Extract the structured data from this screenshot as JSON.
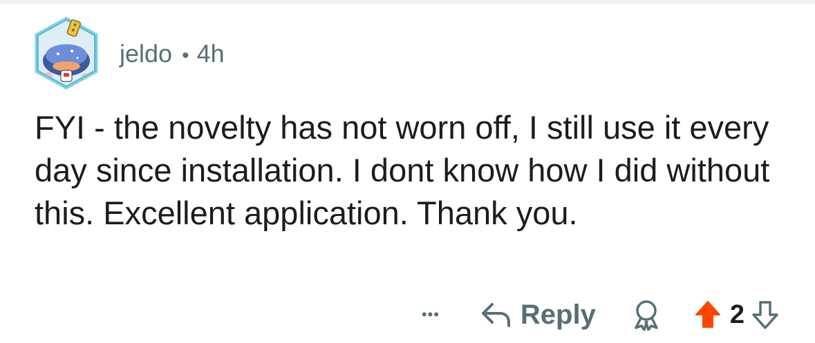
{
  "comment": {
    "author": "jeldo",
    "separator": "•",
    "age": "4h",
    "text": "FYI - the novelty has not worn off, I still use it every day since installation. I dont know how I did without this. Excellent application. Thank you."
  },
  "actions": {
    "more_label": "•••",
    "reply_label": "Reply",
    "score": "2"
  },
  "colors": {
    "meta_text": "#576f76",
    "body_text": "#1c1c1c",
    "upvote": "#ff4500",
    "avatar_ring": "#5ab8d6"
  },
  "icons": [
    "avatar",
    "more-icon",
    "reply-arrow-icon",
    "award-icon",
    "upvote-arrow-icon",
    "downvote-arrow-icon"
  ]
}
